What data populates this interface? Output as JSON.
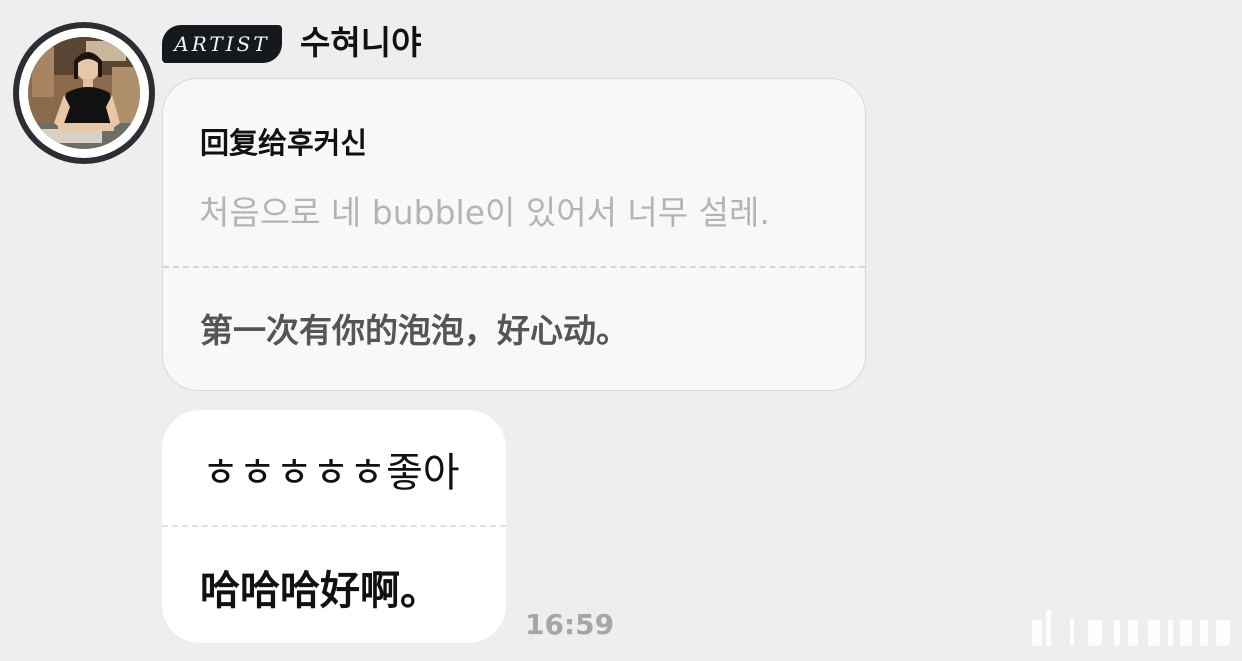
{
  "header": {
    "badge_label": "ARTIST",
    "artist_name": "수혀니야"
  },
  "reply": {
    "reply_to": "回复给후커신",
    "quoted_text": "처음으로 네 bubble이 있어서 너무 설레.",
    "translation": "第一次有你的泡泡，好心动。"
  },
  "message": {
    "text": "ㅎㅎㅎㅎㅎ좋아",
    "translation": "哈哈哈好啊。",
    "time": "16:59"
  },
  "colors": {
    "background": "#eeeeee",
    "badge": "#15191d",
    "reply_bubble": "#f8f8f8",
    "message_bubble": "#ffffff",
    "quote_text": "#b4b4b4",
    "timestamp": "#a6a6a6"
  },
  "icons": [
    "artist-avatar",
    "watermark-icon"
  ]
}
